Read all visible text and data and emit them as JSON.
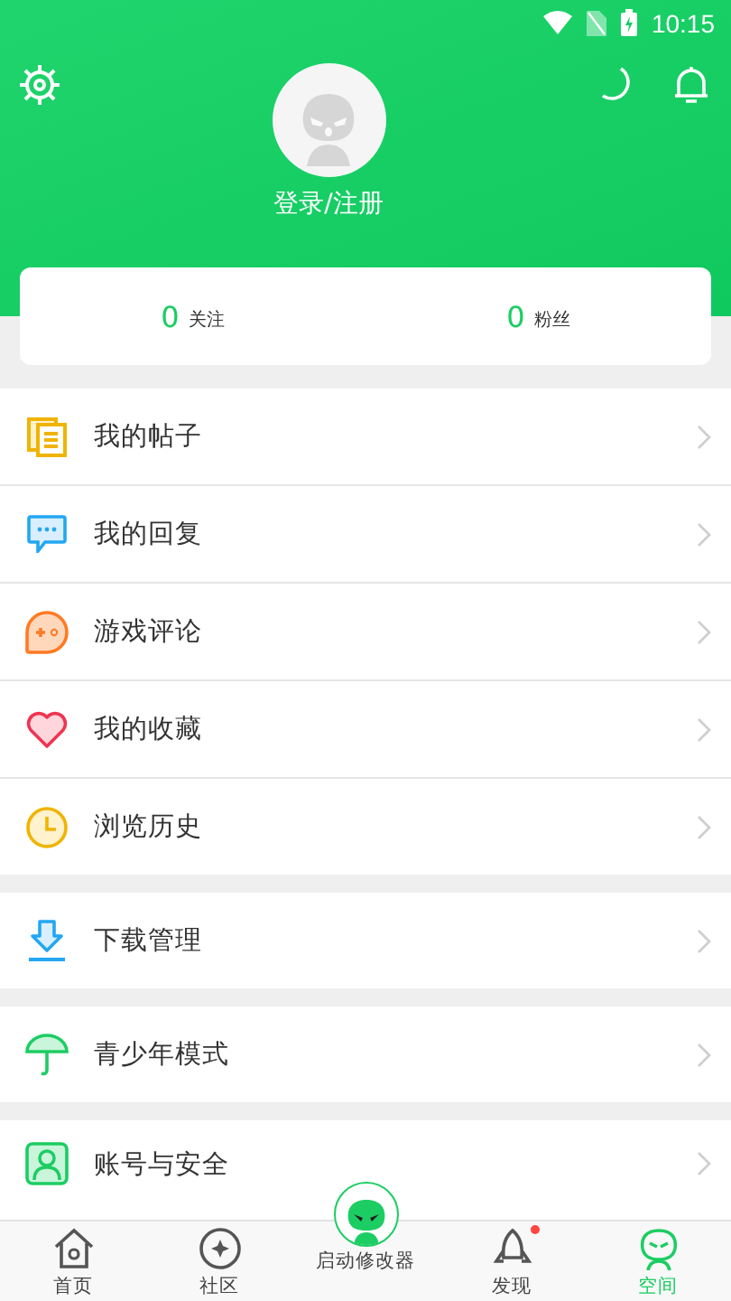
{
  "status_bar": {
    "time": "10:15"
  },
  "profile": {
    "login_label": "登录/注册"
  },
  "stats": [
    {
      "value": "0",
      "label": "关注"
    },
    {
      "value": "0",
      "label": "粉丝"
    }
  ],
  "menu_groups": [
    {
      "items": [
        {
          "label": "我的帖子"
        },
        {
          "label": "我的回复"
        },
        {
          "label": "游戏评论"
        },
        {
          "label": "我的收藏"
        },
        {
          "label": "浏览历史"
        }
      ]
    },
    {
      "items": [
        {
          "label": "下载管理"
        }
      ]
    },
    {
      "items": [
        {
          "label": "青少年模式"
        }
      ]
    },
    {
      "items": [
        {
          "label": "账号与安全"
        }
      ]
    }
  ],
  "bottom_nav": [
    {
      "label": "首页",
      "selected": false
    },
    {
      "label": "社区",
      "selected": false
    },
    {
      "label": "启动修改器",
      "selected": false
    },
    {
      "label": "发现",
      "selected": false,
      "badge": true
    },
    {
      "label": "空间",
      "selected": true
    }
  ]
}
